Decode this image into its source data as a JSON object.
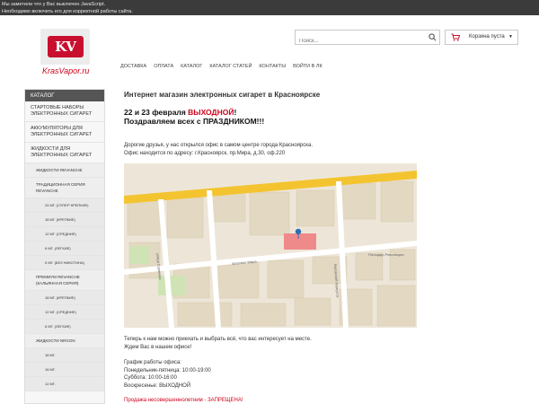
{
  "noscript": {
    "line1": "Мы заметили что у Вас выключен JavaScript.",
    "line2": "Необходимо включить его для корректной работы сайта."
  },
  "logo": {
    "mark": "KV",
    "site_name": "KrasVapor.ru"
  },
  "search": {
    "placeholder": "Поиск..."
  },
  "cart": {
    "label": "Корзина пуста"
  },
  "nav": [
    "ДОСТАВКА",
    "ОПЛАТА",
    "КАТАЛОГ",
    "КАТАЛОГ СТАТЕЙ",
    "КОНТАКТЫ",
    "ВОЙТИ В ЛК"
  ],
  "sidebar": {
    "title": "КАТАЛОГ",
    "items": [
      {
        "label": "СТАРТОВЫЕ НАБОРЫ ЭЛЕКТРОННЫХ СИГАРЕТ",
        "level": 0
      },
      {
        "label": "АККУМУЛЯТОРЫ ДЛЯ ЭЛЕКТРОННЫХ СИГАРЕТ",
        "level": 0
      },
      {
        "label": "ЖИДКОСТИ ДЛЯ ЭЛЕКТРОННЫХ СИГАРЕТ",
        "level": 0
      },
      {
        "label": "ЖИДКОСТИ REVANCHE",
        "level": 1
      },
      {
        "label": "ТРАДИЦИОННАЯ СЕРИЯ REVANCHE",
        "level": 1
      },
      {
        "label": "24 МГ. (СУПЕР КРЕПКИЕ)",
        "level": 2
      },
      {
        "label": "18 МГ. (КРЕПКИЕ)",
        "level": 2
      },
      {
        "label": "12 МГ. (СРЕДНИЕ)",
        "level": 2
      },
      {
        "label": "6 МГ. (ЛЕГКИЕ)",
        "level": 2
      },
      {
        "label": "0 МГ. (БЕЗ НИКОТИНА)",
        "level": 2
      },
      {
        "label": "ПРЕМИУМ REVANCHE (КАЛЬЯННАЯ СЕРИЯ)",
        "level": 1
      },
      {
        "label": "18 МГ. (КРЕПКИЕ)",
        "level": 2
      },
      {
        "label": "12 МГ. (СРЕДНИЕ)",
        "level": 2
      },
      {
        "label": "6 МГ. (ЛЕГКИЕ)",
        "level": 2
      },
      {
        "label": "ЖИДКОСТИ NRGON",
        "level": 1
      },
      {
        "label": "18 МГ.",
        "level": 2
      },
      {
        "label": "16 МГ.",
        "level": 2
      },
      {
        "label": "12 МГ.",
        "level": 2
      }
    ]
  },
  "main": {
    "title": "Интернет магазин электронных сигарет в Красноярске",
    "holiday_prefix": "22 и 23 февраля ",
    "holiday_highlight": "ВЫХОДНОЙ",
    "holiday_suffix": "!",
    "congrats": "Поздравляем всех с ПРАЗДНИКОМ!!!",
    "office_line1": "Дорогие друзья, у нас открылся офис в самом центре города Красноярска.",
    "office_line2": "Офис находится по адресу: г.Красноярск, пр.Мира, д.30, оф.220",
    "come_line1": "Теперь к нам можно приехать и выбрать всё, что вас интересует на месте.",
    "come_line2": "Ждем Вас в нашем офисе!",
    "hours_title": "График работы офиса:",
    "hours_weekdays": "Понедельник-пятница: 10:00-19:00",
    "hours_saturday": "Суббота: 10:00-16:00",
    "hours_sunday": "Воскресенье: ВЫХОДНОЙ",
    "warning": "Продажа несовершеннолетним - ЗАПРЕЩЕНА!"
  },
  "map": {
    "street_main": "проспект Мира",
    "street_vert": "улица Сурикова",
    "street_right": "Кировский переулок",
    "poi": "Площадь Революции"
  },
  "colors": {
    "accent_red": "#d0021b",
    "topbar": "#3b3b3b",
    "sidebar_head": "#555555",
    "map_road_main": "#f4c430",
    "map_block": "#e5dac6",
    "map_highlight": "#ef8a8a"
  },
  "icons": {
    "search": "search-icon",
    "cart": "cart-icon",
    "map_pin": "map-pin-icon"
  }
}
